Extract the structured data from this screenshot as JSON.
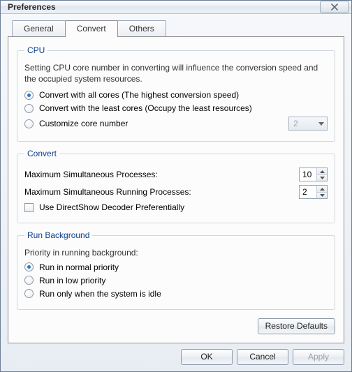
{
  "window": {
    "title": "Preferences"
  },
  "tabs": {
    "general": "General",
    "convert": "Convert",
    "others": "Others",
    "active": "convert"
  },
  "cpu": {
    "legend": "CPU",
    "desc": "Setting CPU core number in converting will influence the conversion speed and the occupied system resources.",
    "opt_all": "Convert with all cores (The highest conversion speed)",
    "opt_least": "Convert with the least cores (Occupy the least resources)",
    "opt_custom": "Customize core number",
    "selected": "all",
    "custom_value": "2"
  },
  "convert": {
    "legend": "Convert",
    "max_proc_label": "Maximum Simultaneous Processes:",
    "max_proc_value": "10",
    "max_run_label": "Maximum Simultaneous Running Processes:",
    "max_run_value": "2",
    "directshow_label": "Use DirectShow Decoder Preferentially",
    "directshow_checked": false
  },
  "runbg": {
    "legend": "Run Background",
    "heading": "Priority in running background:",
    "opt_normal": "Run in normal priority",
    "opt_low": "Run in low priority",
    "opt_idle": "Run only when the system is idle",
    "selected": "normal"
  },
  "buttons": {
    "restore": "Restore Defaults",
    "ok": "OK",
    "cancel": "Cancel",
    "apply": "Apply"
  }
}
